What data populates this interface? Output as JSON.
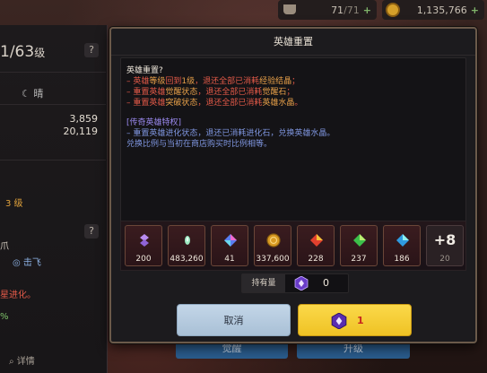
{
  "top_bar": {
    "stamina": "71",
    "stamina_max": "71",
    "gold": "1,135,766"
  },
  "left_panel": {
    "level_num": "1",
    "level_max": "/63",
    "level_unit": "级",
    "help_mark": "?",
    "moon_label": "晴",
    "stat_1": "3,859",
    "stat_2": "20,119",
    "rank_text": "3 级",
    "claw_text": "爪",
    "fly_text": "击飞",
    "evolve_text": "星进化。",
    "percent_text": "%",
    "detail_text": "详情"
  },
  "bottom_tabs": {
    "awaken": "觉醒",
    "upgrade": "升级"
  },
  "dialog": {
    "title": "英雄重置",
    "question": "英雄重置?",
    "l1_a": "– 英雄",
    "l1_b": "等级",
    "l1_c": "回到",
    "l1_d": "1级",
    "l1_e": "，退还全部已消耗",
    "l1_f": "经验结晶",
    "l1_g": "；",
    "l2_a": "– 重置英雄",
    "l2_b": "觉醒状态",
    "l2_c": "，退还全部已消耗",
    "l2_d": "觉醒石",
    "l2_e": "；",
    "l3_a": "– 重置英雄",
    "l3_b": "突破状态",
    "l3_c": "，退还全部已消耗",
    "l3_d": "英雄水晶",
    "l3_e": "。",
    "legend_header": "[传奇英雄特权]",
    "legend_1": "– 重置英雄进化状态，退还已消耗进化石，兑换英雄水晶。",
    "legend_2": "兑换比例与当初在商店购买时比例相等。",
    "items": [
      {
        "icon": "purple-gem-stack-icon",
        "qty": "200"
      },
      {
        "icon": "exp-crystal-icon",
        "qty": "483,260"
      },
      {
        "icon": "prism-diamond-icon",
        "qty": "41"
      },
      {
        "icon": "gold-coin-icon",
        "qty": "337,600"
      },
      {
        "icon": "red-stone-icon",
        "qty": "228"
      },
      {
        "icon": "green-stone-icon",
        "qty": "237"
      },
      {
        "icon": "blue-stone-icon",
        "qty": "186"
      }
    ],
    "more_label": "+8",
    "more_qty": "20",
    "hold_label": "持有量",
    "hold_value": "0",
    "cancel_label": "取消",
    "confirm_value": "1"
  }
}
